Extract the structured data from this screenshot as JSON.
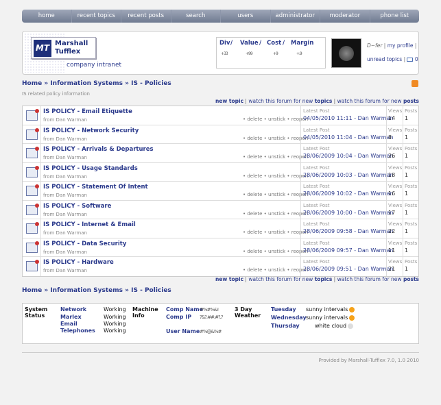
{
  "nav": [
    "home",
    "recent topics",
    "recent posts",
    "search",
    "users",
    "administrator",
    "moderator",
    "phone list"
  ],
  "header": {
    "logo_line1": "Marshall",
    "logo_line2": "Tufflex",
    "logo_mark": "MT",
    "intranet": "company intranet",
    "kpi": {
      "div": "Div",
      "value": "Value",
      "cost": "Cost",
      "margin": "Margin",
      "div_v": "+33",
      "value_v": "+99",
      "cost_v": "+9",
      "margin_v": "+.9"
    },
    "user_sig": "D~fer",
    "my_profile": "my profile",
    "unread": "unread topics",
    "mail_count": "0"
  },
  "breadcrumb": {
    "home": "Home",
    "sec": "Information Systems",
    "forum": "IS - Policies",
    "sep": "»"
  },
  "subtitle": "IS related policy information",
  "actions": {
    "new_topic": "new topic",
    "watch_topics_pre": "watch this forum for new",
    "watch_topics": "topics",
    "watch_posts_pre": "watch this forum for new",
    "watch_posts": "posts"
  },
  "labels": {
    "latest_post": "Latest Post",
    "views": "Views",
    "posts": "Posts",
    "from": "from",
    "delete": "delete",
    "unstick": "unstick",
    "reopen": "reopen"
  },
  "topics": [
    {
      "title": "IS POLICY - Email Etiquette",
      "author": "Dan Warman",
      "latest": "04/05/2010 11:11 - Dan Warman",
      "views": "14",
      "posts": "1"
    },
    {
      "title": "IS POLICY - Network Security",
      "author": "Dan Warman",
      "latest": "04/05/2010 11:04 - Dan Warman",
      "views": "8",
      "posts": "1"
    },
    {
      "title": "IS POLICY - Arrivals & Departures",
      "author": "Dan Warman",
      "latest": "28/06/2009 10:04 - Dan Warman",
      "views": "26",
      "posts": "1"
    },
    {
      "title": "IS POLICY - Usage Standards",
      "author": "Dan Warman",
      "latest": "28/06/2009 10:03 - Dan Warman",
      "views": "18",
      "posts": "1"
    },
    {
      "title": "IS POLICY - Statement Of Intent",
      "author": "Dan Warman",
      "latest": "28/06/2009 10:02 - Dan Warman",
      "views": "16",
      "posts": "1"
    },
    {
      "title": "IS POLICY - Software",
      "author": "Dan Warman",
      "latest": "28/06/2009 10:00 - Dan Warman",
      "views": "17",
      "posts": "1"
    },
    {
      "title": "IS POLICY - Internet & Email",
      "author": "Dan Warman",
      "latest": "28/06/2009 09:58 - Dan Warman",
      "views": "22",
      "posts": "1"
    },
    {
      "title": "IS POLICY - Data Security",
      "author": "Dan Warman",
      "latest": "28/06/2009 09:57 - Dan Warman",
      "views": "11",
      "posts": "1"
    },
    {
      "title": "IS POLICY - Hardware",
      "author": "Dan Warman",
      "latest": "28/06/2009 09:51 - Dan Warman",
      "views": "21",
      "posts": "1"
    }
  ],
  "status": {
    "system_status": "System Status",
    "items": [
      {
        "name": "Network",
        "state": "Working"
      },
      {
        "name": "Marlex",
        "state": "Working"
      },
      {
        "name": "Email",
        "state": "Working"
      },
      {
        "name": "Telephones",
        "state": "Working"
      }
    ],
    "machine_info": "Machine Info",
    "comp_name": "Comp Name",
    "comp_ip": "Comp IP",
    "user_name": "User Name",
    "comp_name_v": "#%#%&!",
    "comp_ip_v": "?&?.##.#?.?",
    "user_name_v": "#%@&%#",
    "weather_title": "3 Day Weather",
    "weather": [
      {
        "day": "Tuesday",
        "desc": "sunny intervals",
        "icon": "sun"
      },
      {
        "day": "Wednesday",
        "desc": "sunny intervals",
        "icon": "sun"
      },
      {
        "day": "Thursday",
        "desc": "white cloud",
        "icon": "cloud"
      }
    ]
  },
  "footer": "Provided by Marshall-Tufflex 7.0, 1.0 2010"
}
